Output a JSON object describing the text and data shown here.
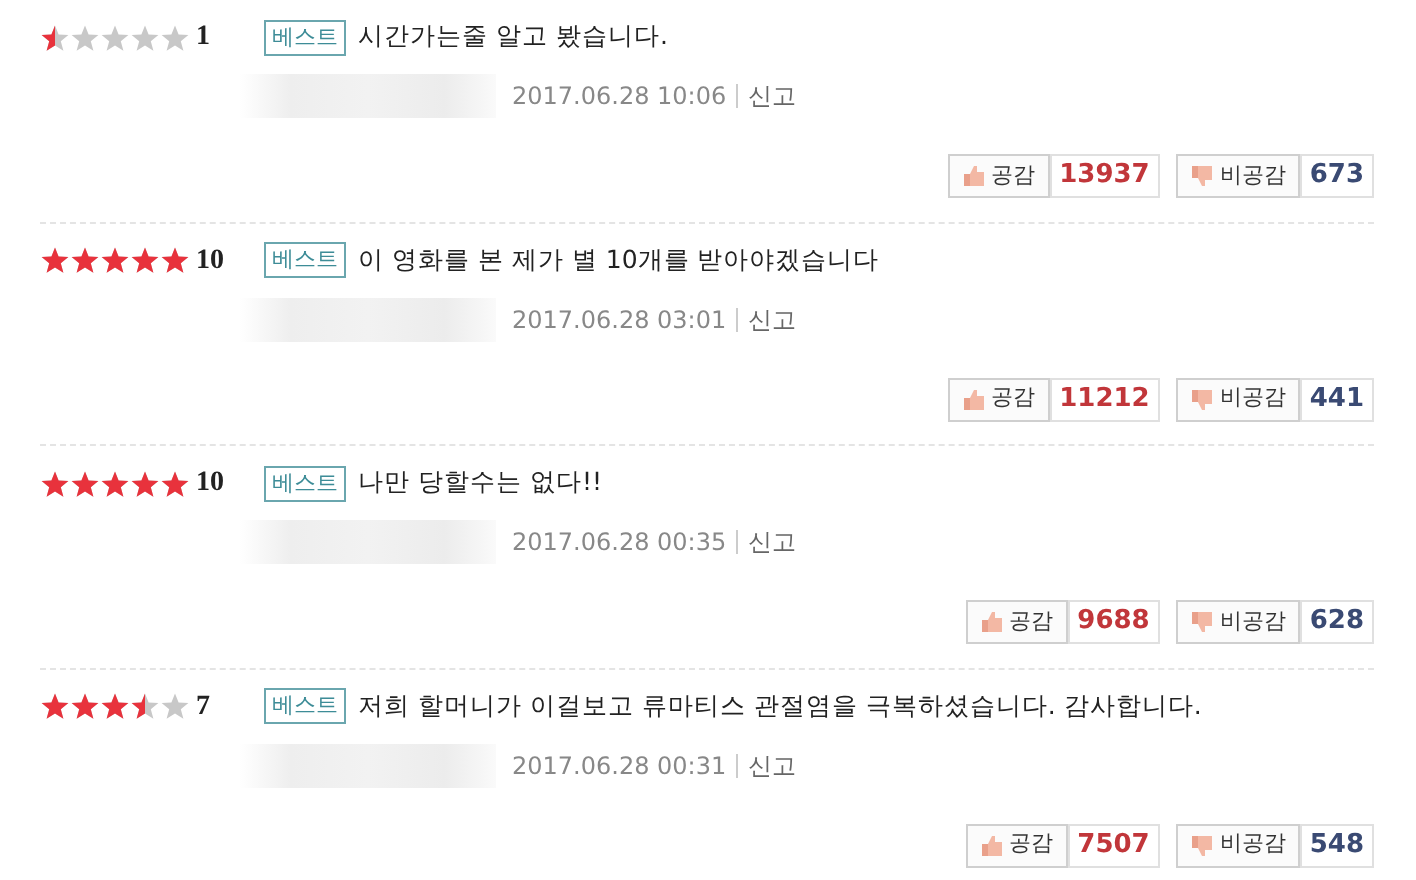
{
  "reviews": [
    {
      "stars": 0.5,
      "score": "1",
      "badge": "베스트",
      "text": "시간가는줄 알고 봤습니다.",
      "date": "2017.06.28 10:06",
      "report": "신고",
      "like_label": "공감",
      "likes": "13937",
      "dislike_label": "비공감",
      "dislikes": "673"
    },
    {
      "stars": 5,
      "score": "10",
      "badge": "베스트",
      "text": "이 영화를 본 제가 별 10개를 받아야겠습니다",
      "date": "2017.06.28 03:01",
      "report": "신고",
      "like_label": "공감",
      "likes": "11212",
      "dislike_label": "비공감",
      "dislikes": "441"
    },
    {
      "stars": 5,
      "score": "10",
      "badge": "베스트",
      "text": "나만 당할수는 없다!!",
      "date": "2017.06.28 00:35",
      "report": "신고",
      "like_label": "공감",
      "likes": "9688",
      "dislike_label": "비공감",
      "dislikes": "628"
    },
    {
      "stars": 3.5,
      "score": "7",
      "badge": "베스트",
      "text": "저희 할머니가 이걸보고 류마티스 관절염을 극복하셨습니다. 감사합니다.",
      "date": "2017.06.28 00:31",
      "report": "신고",
      "like_label": "공감",
      "likes": "7507",
      "dislike_label": "비공감",
      "dislikes": "548"
    }
  ]
}
